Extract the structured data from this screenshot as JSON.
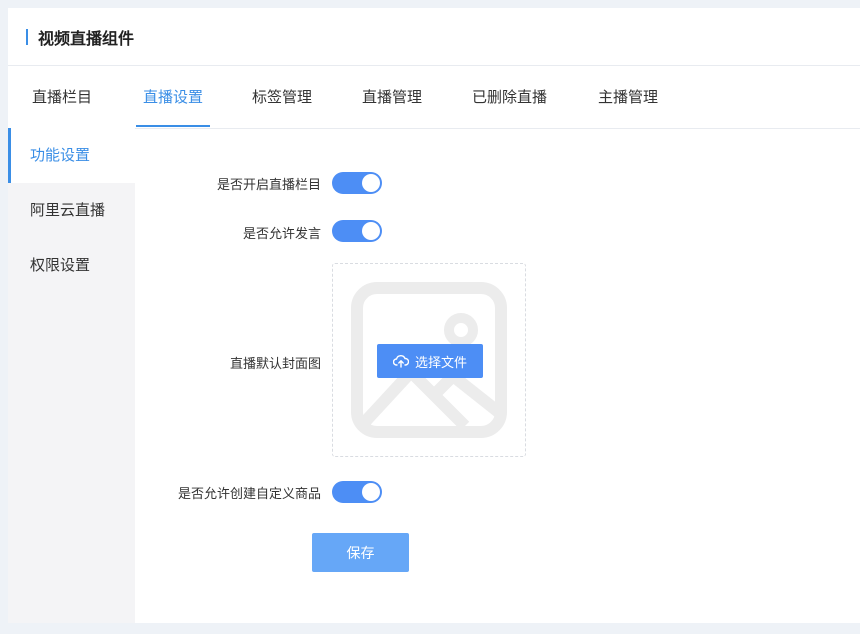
{
  "header": {
    "title": "视频直播组件"
  },
  "tabs": [
    {
      "label": "直播栏目"
    },
    {
      "label": "直播设置"
    },
    {
      "label": "标签管理"
    },
    {
      "label": "直播管理"
    },
    {
      "label": "已删除直播"
    },
    {
      "label": "主播管理"
    }
  ],
  "active_tab": "直播设置",
  "sidebar": {
    "items": [
      {
        "label": "功能设置"
      },
      {
        "label": "阿里云直播"
      },
      {
        "label": "权限设置"
      }
    ],
    "active": "功能设置"
  },
  "form": {
    "enable_column": {
      "label": "是否开启直播栏目",
      "on": true
    },
    "allow_comment": {
      "label": "是否允许发言",
      "on": true
    },
    "cover": {
      "label": "直播默认封面图",
      "button_label": "选择文件"
    },
    "allow_custom_goods": {
      "label": "是否允许创建自定义商品",
      "on": true
    },
    "save_label": "保存"
  },
  "colors": {
    "accent": "#3a8ee6",
    "switch_on": "#4d8ef5",
    "save": "#66a7f7"
  }
}
